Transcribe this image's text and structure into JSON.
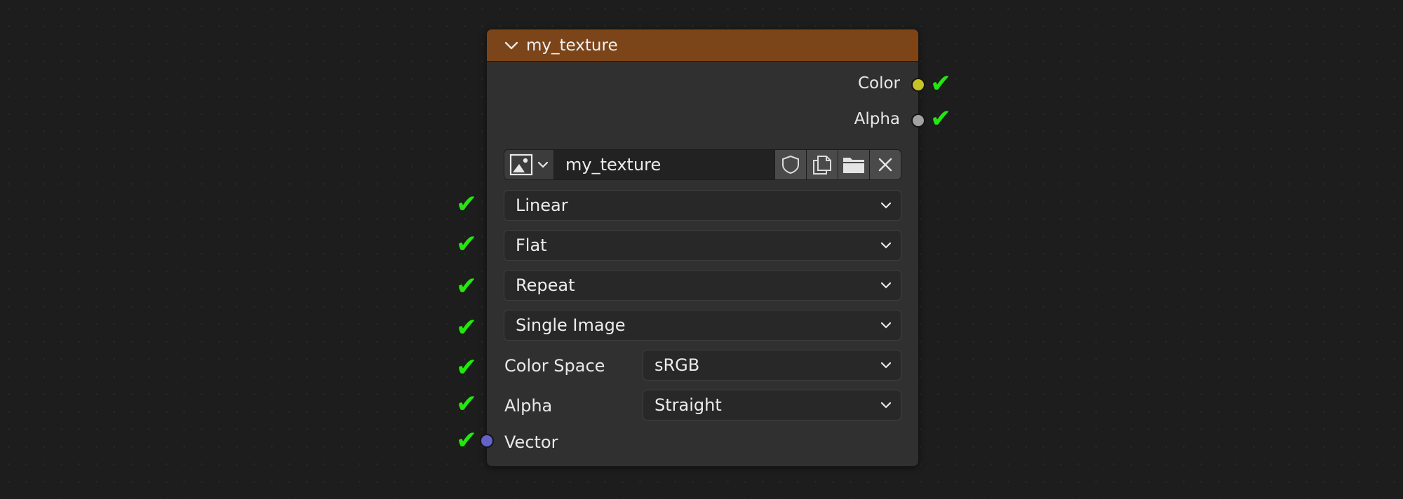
{
  "node": {
    "title": "my_texture",
    "outputs": [
      {
        "label": "Color",
        "socket_color": "#c7c229"
      },
      {
        "label": "Alpha",
        "socket_color": "#a1a1a1"
      }
    ],
    "image": {
      "name": "my_texture"
    },
    "dropdowns": {
      "interpolation": "Linear",
      "projection": "Flat",
      "extension": "Repeat",
      "source": "Single Image"
    },
    "color_space": {
      "label": "Color Space",
      "value": "sRGB"
    },
    "alpha": {
      "label": "Alpha",
      "value": "Straight"
    },
    "vector_input": {
      "label": "Vector",
      "socket_color": "#6363c7"
    }
  },
  "checkmark": "✔",
  "colors": {
    "header": "#7b4519",
    "check": "#22e80e",
    "node_body": "#303030"
  }
}
